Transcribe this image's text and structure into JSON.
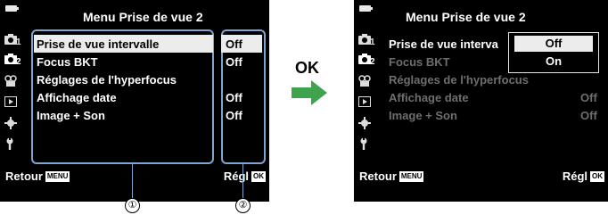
{
  "left_screen": {
    "title": "Menu Prise de vue 2",
    "tabs": [
      "1",
      "2"
    ],
    "items": [
      {
        "label": "Prise de vue intervalle",
        "value": "Off"
      },
      {
        "label": "Focus BKT",
        "value": "Off"
      },
      {
        "label": "Réglages de l'hyperfocus",
        "value": ""
      },
      {
        "label": "Affichage date",
        "value": "Off"
      },
      {
        "label": "Image + Son",
        "value": "Off"
      }
    ],
    "footer": {
      "back": "Retour",
      "back_key": "MENU",
      "set": "Régl",
      "set_key": "OK"
    }
  },
  "arrow_label": "OK",
  "callouts": [
    "①",
    "②"
  ],
  "right_screen": {
    "title": "Menu Prise de vue 2",
    "tabs": [
      "1",
      "2"
    ],
    "items": [
      {
        "label": "Prise de vue interva",
        "value": ""
      },
      {
        "label": "Focus BKT",
        "value": ""
      },
      {
        "label": "Réglages de l'hyperfocus",
        "value": ""
      },
      {
        "label": "Affichage date",
        "value": "Off"
      },
      {
        "label": "Image + Son",
        "value": "Off"
      }
    ],
    "popup_options": [
      "Off",
      "On"
    ],
    "footer": {
      "back": "Retour",
      "back_key": "MENU",
      "set": "Régl",
      "set_key": "OK"
    }
  },
  "colors": {
    "highlight": "#ececec",
    "callout_lines": "#7ea6cf",
    "arrow": "#3fa34d",
    "dim_text": "#6e6e6e"
  },
  "icons": [
    "battery-icon",
    "camera-1-icon",
    "camera-2-icon",
    "video-icon",
    "playback-icon",
    "gear-icon",
    "wrench-icon",
    "arrow-right-icon"
  ]
}
